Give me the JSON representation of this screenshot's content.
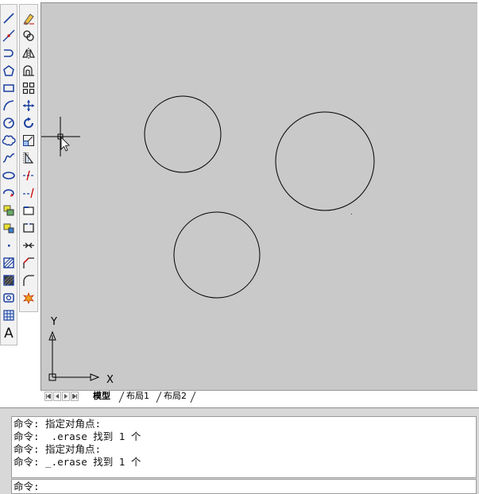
{
  "draw_toolbar": {
    "tools": [
      {
        "icon": "line-icon"
      },
      {
        "icon": "construction-line-icon"
      },
      {
        "icon": "polyline-icon"
      },
      {
        "icon": "polygon-icon"
      },
      {
        "icon": "rectangle-icon"
      },
      {
        "icon": "arc-icon"
      },
      {
        "icon": "circle-icon"
      },
      {
        "icon": "revision-cloud-icon"
      },
      {
        "icon": "spline-icon"
      },
      {
        "icon": "ellipse-icon"
      },
      {
        "icon": "ellipse-arc-icon"
      },
      {
        "icon": "insert-block-icon"
      },
      {
        "icon": "make-block-icon"
      },
      {
        "icon": "point-icon"
      },
      {
        "icon": "hatch-icon"
      },
      {
        "icon": "gradient-icon"
      },
      {
        "icon": "region-icon"
      },
      {
        "icon": "table-icon"
      },
      {
        "icon": "multiline-text-icon",
        "label": "A"
      }
    ]
  },
  "modify_toolbar": {
    "tools": [
      {
        "icon": "erase-icon"
      },
      {
        "icon": "copy-icon"
      },
      {
        "icon": "mirror-icon"
      },
      {
        "icon": "offset-icon"
      },
      {
        "icon": "array-icon"
      },
      {
        "icon": "move-icon"
      },
      {
        "icon": "rotate-icon"
      },
      {
        "icon": "scale-icon"
      },
      {
        "icon": "stretch-icon"
      },
      {
        "icon": "trim-icon"
      },
      {
        "icon": "extend-icon"
      },
      {
        "icon": "break-at-point-icon"
      },
      {
        "icon": "break-icon"
      },
      {
        "icon": "join-icon"
      },
      {
        "icon": "chamfer-icon"
      },
      {
        "icon": "fillet-icon"
      },
      {
        "icon": "explode-icon"
      }
    ]
  },
  "drawing": {
    "background": "#c9c9c9",
    "ucs": {
      "x_label": "X",
      "y_label": "Y"
    }
  },
  "layout_tabs": {
    "tabs": [
      {
        "label": "模型",
        "active": true
      },
      {
        "label": "布局1",
        "active": false
      },
      {
        "label": "布局2",
        "active": false
      }
    ]
  },
  "command_window": {
    "history": [
      "命令: 指定对角点:",
      "命令:  .erase 找到 1 个",
      "命令: 指定对角点:",
      "命令: _.erase 找到 1 个"
    ],
    "prompt": "命令:",
    "input_value": ""
  }
}
